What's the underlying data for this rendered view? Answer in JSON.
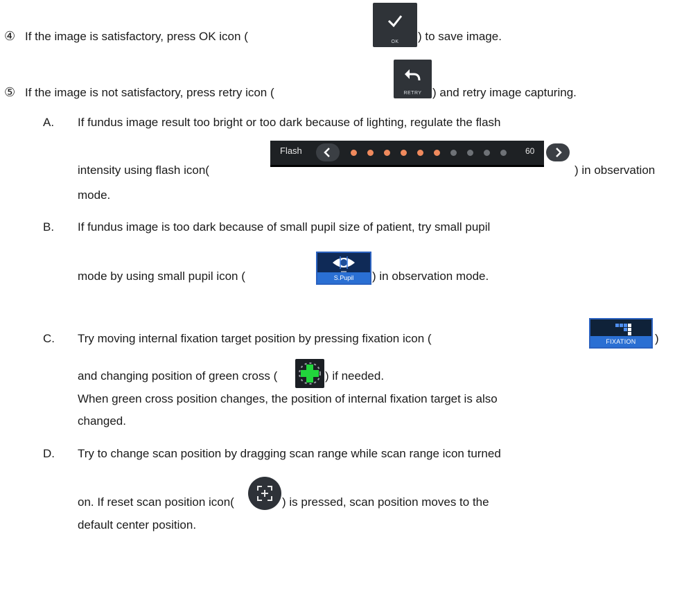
{
  "steps": [
    {
      "marker": "④",
      "before": "If the image is satisfactory, press OK icon (",
      "icon_caption": "OK",
      "after": ") to save image."
    },
    {
      "marker": "⑤",
      "before": "If the image is not satisfactory, press retry icon (",
      "icon_caption": "RETRY",
      "after": ") and retry image capturing."
    }
  ],
  "items": {
    "a": {
      "marker": "A.",
      "line1": "If fundus image result too bright or too dark because of lighting, regulate the flash",
      "line2_before": "intensity using flash icon(",
      "line2_after": ") in observation",
      "line3": "mode.",
      "flash": {
        "label": "Flash",
        "value": "60",
        "active_dots": 6,
        "total_dots": 10,
        "active_color": "#f08a5d",
        "inactive_color": "#6e7277"
      }
    },
    "b": {
      "marker": "B.",
      "line1": "If fundus image is too dark because of small pupil size of patient, try small pupil",
      "line2_before": "mode by using small pupil icon (",
      "line2_after": ") in observation mode.",
      "icon_caption": "S.Pupil"
    },
    "c": {
      "marker": "C.",
      "line1_before": "Try moving internal fixation target position by pressing fixation icon (",
      "line1_after": ")",
      "icon_caption": "FIXATION",
      "line2_before": "and changing position of green cross (",
      "line2_after": ") if needed.",
      "line3": "When green cross position changes, the position of internal fixation target is also",
      "line4": "changed."
    },
    "d": {
      "marker": "D.",
      "line1": "Try to change scan position by dragging scan range while scan range icon turned",
      "line2_before": "on. If reset scan position icon(",
      "line2_after": ") is pressed, scan position moves to the",
      "line3": "default center position."
    }
  },
  "icons": {
    "ok": "check-icon",
    "retry": "undo-arrow-icon",
    "flash": "flash-intensity-slider",
    "small_pupil": "eye-icon",
    "fixation": "fixation-grid-icon",
    "green_cross": "green-cross-icon",
    "reset": "reset-scan-position-icon"
  },
  "colors": {
    "icon_dark": "#2f3338",
    "accent_blue": "#2a6fd3",
    "green_cross": "#22d63c"
  }
}
